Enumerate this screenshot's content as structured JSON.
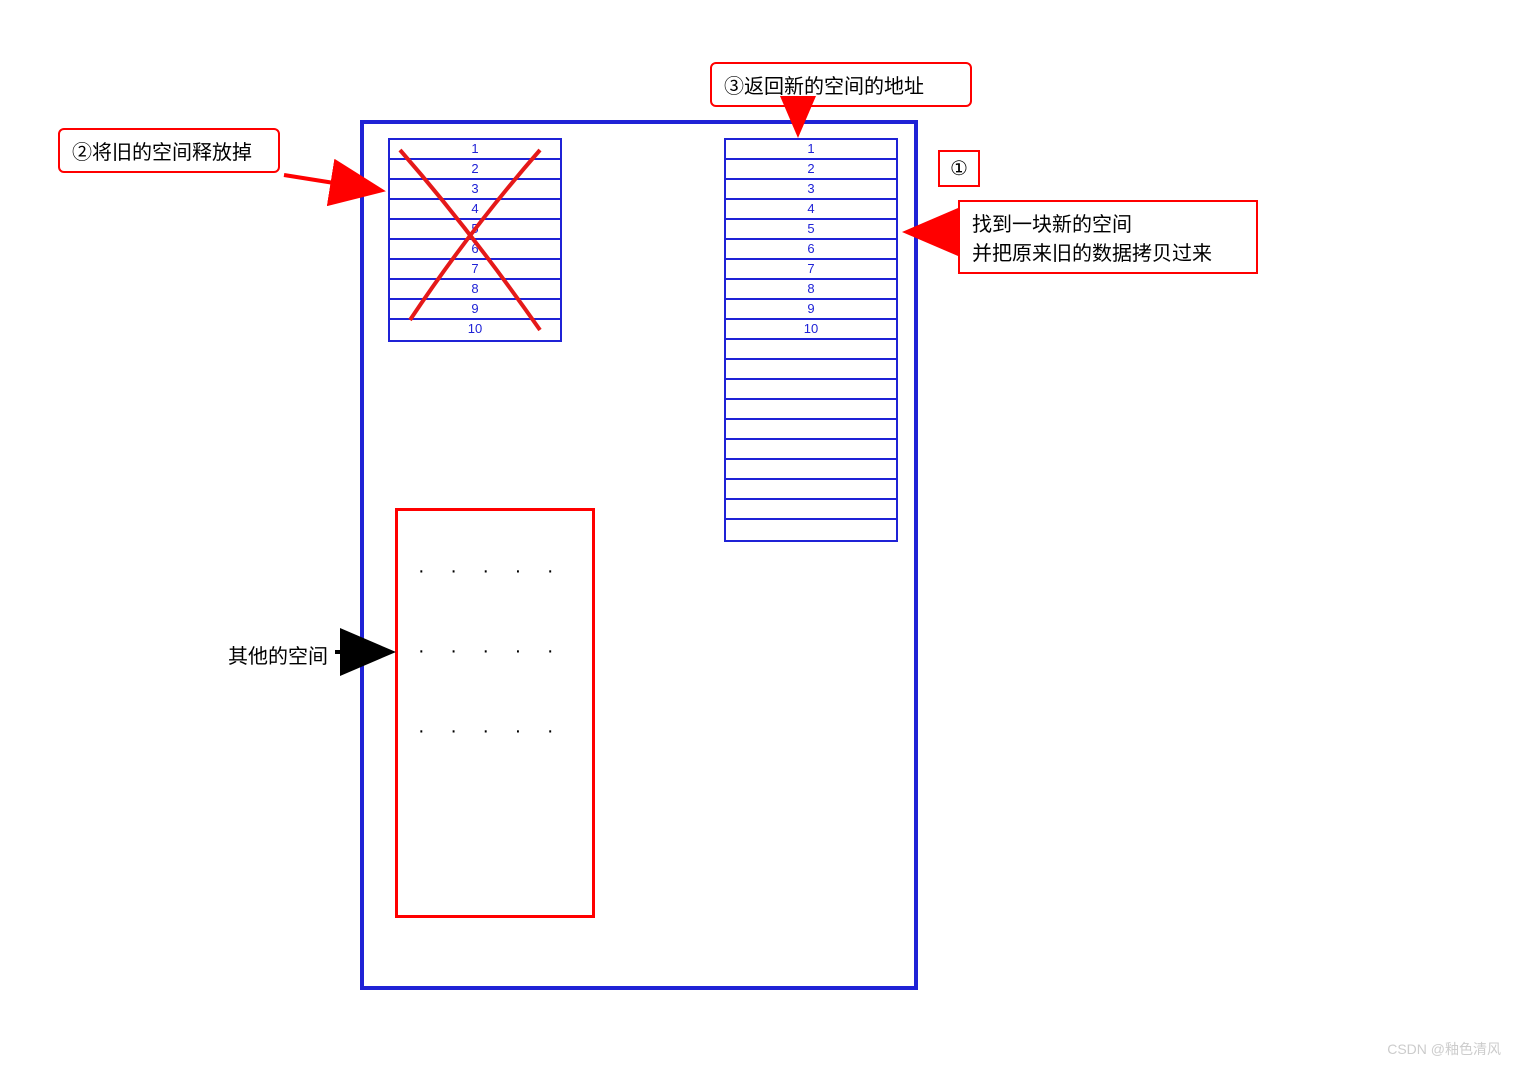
{
  "steps": {
    "step2_label": "②将旧的空间释放掉",
    "step3_label": "③返回新的空间的地址",
    "step1_num": "①",
    "step1_line1": "找到一块新的空间",
    "step1_line2": "并把原来旧的数据拷贝过来"
  },
  "other_space_label": "其他的空间",
  "old_memory_cells": [
    "1",
    "2",
    "3",
    "4",
    "5",
    "6",
    "7",
    "8",
    "9",
    "10"
  ],
  "new_memory_cells": [
    "1",
    "2",
    "3",
    "4",
    "5",
    "6",
    "7",
    "8",
    "9",
    "10",
    "",
    "",
    "",
    "",
    "",
    "",
    "",
    "",
    "",
    ""
  ],
  "watermark": "CSDN @釉色清风"
}
